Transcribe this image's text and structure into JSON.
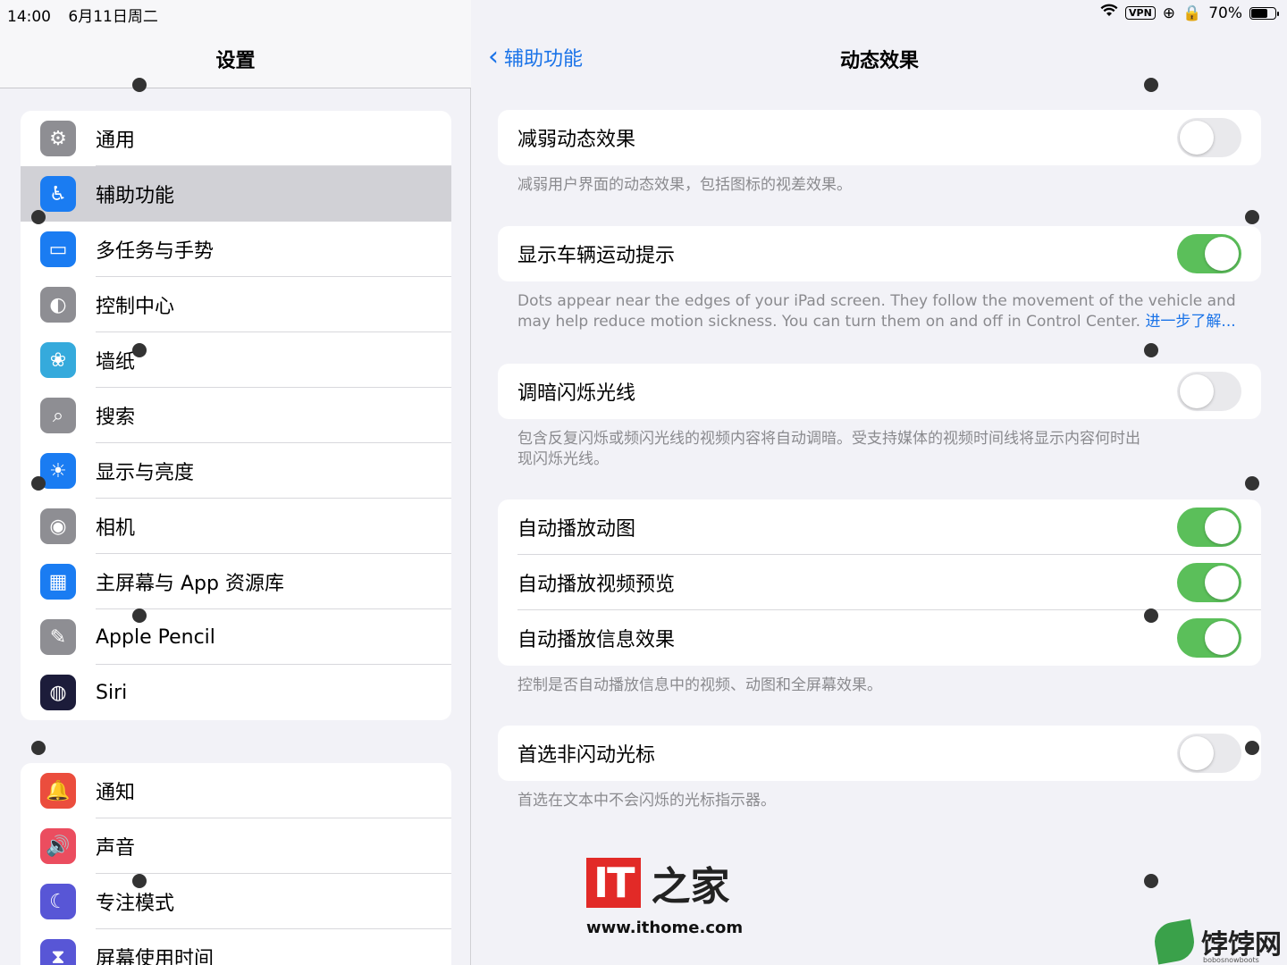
{
  "status": {
    "time": "14:00",
    "date": "6月11日周二",
    "vpn": "VPN",
    "battery": "70%",
    "battery_level": 0.7
  },
  "left": {
    "title": "设置",
    "group1": [
      {
        "label": "通用",
        "icon": "gear-icon",
        "color": "#8e8e93",
        "glyph": "⚙",
        "selected": false
      },
      {
        "label": "辅助功能",
        "icon": "accessibility-icon",
        "color": "#1a7cf2",
        "glyph": "♿",
        "selected": true
      },
      {
        "label": "多任务与手势",
        "icon": "multitasking-icon",
        "color": "#1a7cf2",
        "glyph": "▭",
        "selected": false
      },
      {
        "label": "控制中心",
        "icon": "control-center-icon",
        "color": "#8e8e93",
        "glyph": "◐",
        "selected": false
      },
      {
        "label": "墙纸",
        "icon": "wallpaper-icon",
        "color": "#35aadc",
        "glyph": "❀",
        "selected": false
      },
      {
        "label": "搜索",
        "icon": "search-icon",
        "color": "#8e8e93",
        "glyph": "⌕",
        "selected": false
      },
      {
        "label": "显示与亮度",
        "icon": "brightness-icon",
        "color": "#1a7cf2",
        "glyph": "☀",
        "selected": false
      },
      {
        "label": "相机",
        "icon": "camera-icon",
        "color": "#8e8e93",
        "glyph": "◉",
        "selected": false
      },
      {
        "label": "主屏幕与 App 资源库",
        "icon": "home-screen-icon",
        "color": "#1a7cf2",
        "glyph": "▦",
        "selected": false
      },
      {
        "label": "Apple Pencil",
        "icon": "pencil-icon",
        "color": "#8e8e93",
        "glyph": "✎",
        "selected": false
      },
      {
        "label": "Siri",
        "icon": "siri-icon",
        "color": "#1c1c3a",
        "glyph": "◍",
        "selected": false
      }
    ],
    "group2": [
      {
        "label": "通知",
        "icon": "notification-bell-icon",
        "color": "#eb4d3d",
        "glyph": "🔔"
      },
      {
        "label": "声音",
        "icon": "sound-icon",
        "color": "#eb4d5f",
        "glyph": "🔊"
      },
      {
        "label": "专注模式",
        "icon": "focus-moon-icon",
        "color": "#5856d6",
        "glyph": "☾"
      },
      {
        "label": "屏幕使用时间",
        "icon": "screen-time-icon",
        "color": "#5856d6",
        "glyph": "⧗"
      }
    ]
  },
  "right": {
    "back_label": "辅助功能",
    "title": "动态效果",
    "reduce_motion": {
      "label": "减弱动态效果",
      "on": false
    },
    "reduce_motion_note": "减弱用户界面的动态效果，包括图标的视差效果。",
    "vehicle_cues": {
      "label": "显示车辆运动提示",
      "on": true
    },
    "vehicle_cues_note": "Dots appear near the edges of your iPad screen. They follow the movement of the vehicle and may help reduce motion sickness. You can turn them on and off in Control Center.",
    "vehicle_cues_link": "进一步了解...",
    "dim_flashing": {
      "label": "调暗闪烁光线",
      "on": false
    },
    "dim_flashing_note": "包含反复闪烁或频闪光线的视频内容将自动调暗。受支持媒体的视频时间线将显示内容何时出现闪烁光线。",
    "autoplay": [
      {
        "label": "自动播放动图",
        "on": true
      },
      {
        "label": "自动播放视频预览",
        "on": true
      },
      {
        "label": "自动播放信息效果",
        "on": true
      }
    ],
    "autoplay_note": "控制是否自动播放信息中的视频、动图和全屏幕效果。",
    "non_blinking_cursor": {
      "label": "首选非闪动光标",
      "on": false
    },
    "non_blinking_cursor_note": "首选在文本中不会闪烁的光标指示器。"
  },
  "watermark": {
    "logo_text": "IT",
    "logo_zh": "之家",
    "url": "www.ithome.com",
    "site_name": "饽饽网",
    "site_sub": "bobosnowboots"
  },
  "colors": {
    "accent": "#1a73e8",
    "toggle_on": "#5bbf5a"
  }
}
